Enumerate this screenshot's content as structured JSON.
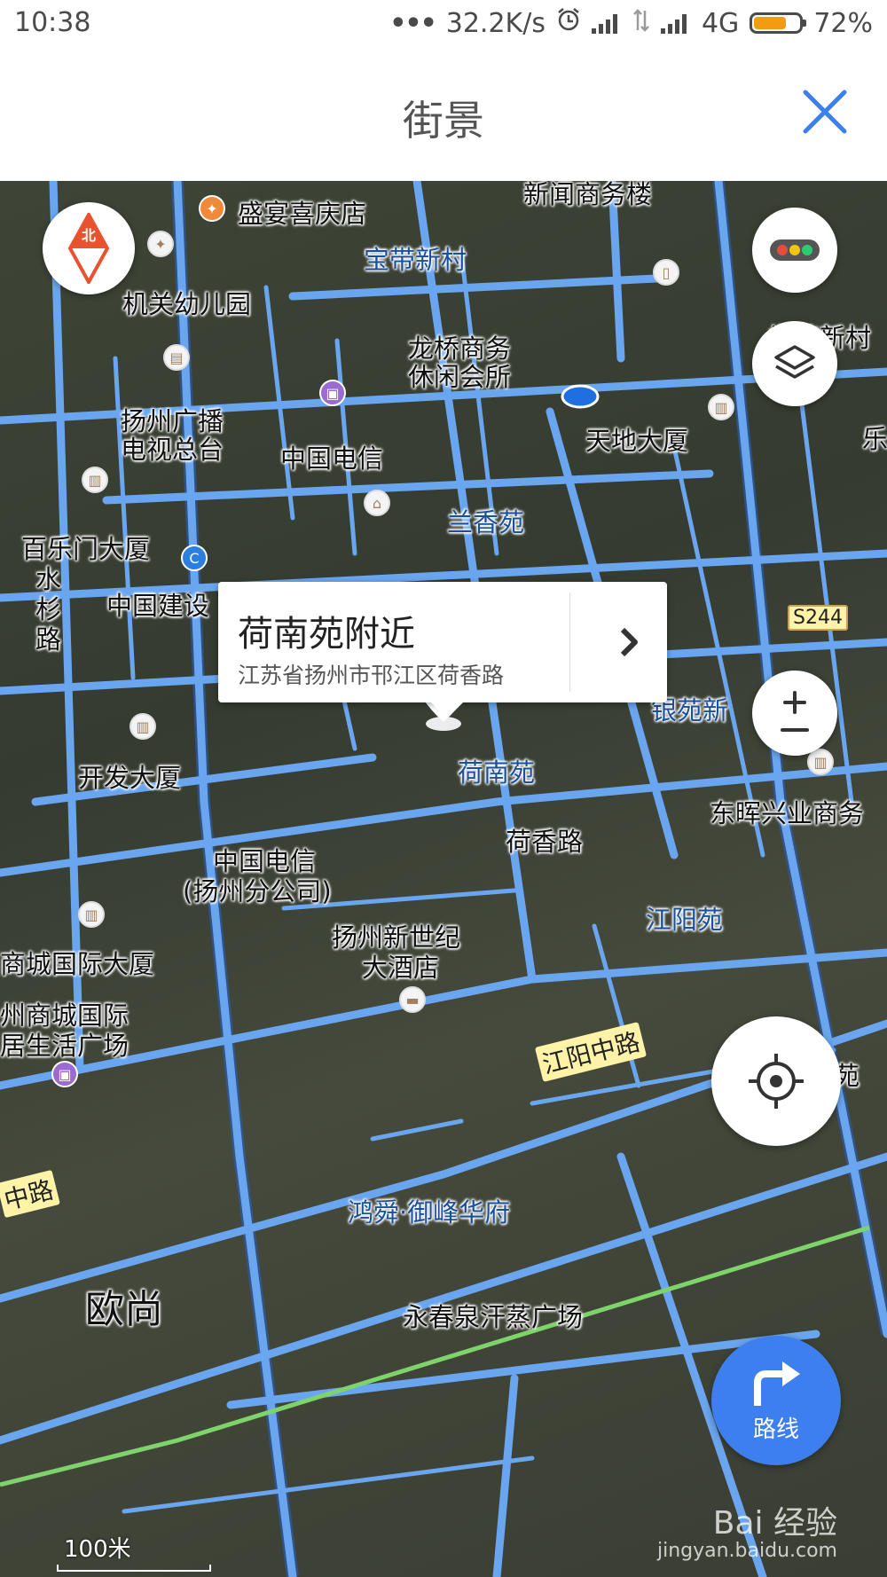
{
  "status_bar": {
    "time": "10:38",
    "dots": "•••",
    "speed": "32.2K/s",
    "network": "4G",
    "battery_percent": "72%",
    "battery_level": 0.72
  },
  "header": {
    "title": "街景"
  },
  "map": {
    "labels": [
      {
        "text": "盛宴喜庆店"
      },
      {
        "text": "新闻商务楼"
      },
      {
        "text": "宝带新村"
      },
      {
        "text": "机关幼儿园"
      },
      {
        "text": "学苑新村"
      },
      {
        "text": "龙桥商务"
      },
      {
        "text": "休闲会所"
      },
      {
        "text": "扬州广播"
      },
      {
        "text": "电视总台"
      },
      {
        "text": "中国电信"
      },
      {
        "text": "天地大厦"
      },
      {
        "text": "兰香苑"
      },
      {
        "text": "百乐门大厦"
      },
      {
        "text": "水"
      },
      {
        "text": "杉"
      },
      {
        "text": "路"
      },
      {
        "text": "中国建设"
      },
      {
        "text": "银苑新"
      },
      {
        "text": "开发大厦"
      },
      {
        "text": "荷南苑"
      },
      {
        "text": "东晖兴业商务"
      },
      {
        "text": "荷香路"
      },
      {
        "text": "中国电信"
      },
      {
        "text": "(扬州分公司)"
      },
      {
        "text": "江阳苑"
      },
      {
        "text": "扬州新世纪"
      },
      {
        "text": "大酒店"
      },
      {
        "text": "商城国际大厦"
      },
      {
        "text": "州商城国际"
      },
      {
        "text": "居生活广场"
      },
      {
        "text": "江阳中路"
      },
      {
        "text": "中路"
      },
      {
        "text": "鸿舜·御峰华府"
      },
      {
        "text": "欧尚"
      },
      {
        "text": "永春泉汗蒸广场"
      },
      {
        "text": "乐"
      },
      {
        "text": "苑"
      }
    ],
    "road_shield": "S244",
    "scale_label": "100米"
  },
  "callout": {
    "title": "荷南苑附近",
    "address": "江苏省扬州市邗江区荷香路"
  },
  "controls": {
    "compass_label": "北",
    "route_label": "路线"
  },
  "watermark": {
    "text": "Bai 经验",
    "sub": "jingyan.baidu.com"
  },
  "colors": {
    "road": "#6aa6f0",
    "accent": "#3d7fef",
    "compass": "#e8522f"
  }
}
